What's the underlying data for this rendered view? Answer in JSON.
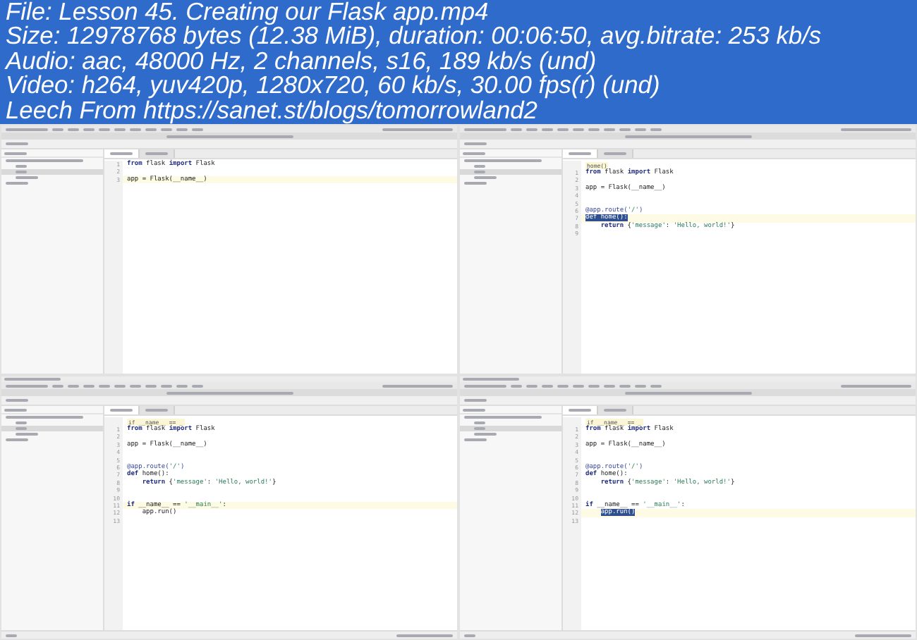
{
  "header": {
    "lines": [
      "File: Lesson 45. Creating our Flask app.mp4",
      "Size: 12978768 bytes (12.38 MiB), duration: 00:06:50, avg.bitrate: 253 kb/s",
      "Audio: aac, 48000 Hz, 2 channels, s16, 189 kb/s (und)",
      "Video: h264, yuv420p, 1280x720, 60 kb/s, 30.00 fps(r) (und)",
      "Leech From https://sanet.st/blogs/tomorrowland2"
    ]
  },
  "frames": [
    {
      "notification": false,
      "status_bar": false,
      "tabs": [
        {
          "selected": true
        },
        {
          "selected": false
        }
      ],
      "lines": [
        {
          "num": "1",
          "current": false,
          "tokens": [
            {
              "text": "from",
              "kind": "kw"
            },
            {
              "text": " flask ",
              "kind": "plain"
            },
            {
              "text": "import",
              "kind": "kw"
            },
            {
              "text": " Flask",
              "kind": "plain"
            }
          ]
        },
        {
          "num": "2",
          "current": false
        },
        {
          "num": "3",
          "current": true,
          "tokens": [
            {
              "text": "app = Flask(__name__)",
              "kind": "plain"
            }
          ]
        }
      ]
    },
    {
      "notification": false,
      "status_bar": false,
      "breadcrumb": "home()",
      "tabs": [
        {
          "selected": true
        },
        {
          "selected": false
        }
      ],
      "lines": [
        {
          "num": "1",
          "current": false,
          "tokens": [
            {
              "text": "from",
              "kind": "kw"
            },
            {
              "text": " flask ",
              "kind": "plain"
            },
            {
              "text": "import",
              "kind": "kw"
            },
            {
              "text": " Flask",
              "kind": "plain"
            }
          ]
        },
        {
          "num": "2",
          "current": false
        },
        {
          "num": "3",
          "current": false,
          "tokens": [
            {
              "text": "app = Flask(__name__)",
              "kind": "plain"
            }
          ]
        },
        {
          "num": "4",
          "current": false
        },
        {
          "num": "5",
          "current": false
        },
        {
          "num": "6",
          "current": false,
          "tokens": [
            {
              "text": "@app.route(",
              "kind": "deco"
            },
            {
              "text": "'/'",
              "kind": "str"
            },
            {
              "text": ")",
              "kind": "deco"
            }
          ]
        },
        {
          "num": "7",
          "current": true,
          "tokens": [
            {
              "text": "def home():",
              "kind": "sel"
            }
          ]
        },
        {
          "num": "8",
          "current": false,
          "indented": true,
          "tokens": [
            {
              "text": "return",
              "kind": "kw"
            },
            {
              "text": " {",
              "kind": "plain"
            },
            {
              "text": "'message'",
              "kind": "str"
            },
            {
              "text": ": ",
              "kind": "plain"
            },
            {
              "text": "'Hello, world!'",
              "kind": "str"
            },
            {
              "text": "}",
              "kind": "plain"
            }
          ]
        },
        {
          "num": "9",
          "current": false
        }
      ]
    },
    {
      "notification": true,
      "status_bar": true,
      "breadcrumb": "if __name__ == _",
      "tabs": [
        {
          "selected": true
        },
        {
          "selected": false
        }
      ],
      "lines": [
        {
          "num": "1",
          "current": false,
          "tokens": [
            {
              "text": "from",
              "kind": "kw"
            },
            {
              "text": " flask ",
              "kind": "plain"
            },
            {
              "text": "import",
              "kind": "kw"
            },
            {
              "text": " Flask",
              "kind": "plain"
            }
          ]
        },
        {
          "num": "2",
          "current": false
        },
        {
          "num": "3",
          "current": false,
          "tokens": [
            {
              "text": "app = Flask(__name__)",
              "kind": "plain"
            }
          ]
        },
        {
          "num": "4",
          "current": false
        },
        {
          "num": "5",
          "current": false
        },
        {
          "num": "6",
          "current": false,
          "tokens": [
            {
              "text": "@app.route(",
              "kind": "deco"
            },
            {
              "text": "'/'",
              "kind": "str"
            },
            {
              "text": ")",
              "kind": "deco"
            }
          ]
        },
        {
          "num": "7",
          "current": false,
          "tokens": [
            {
              "text": "def",
              "kind": "kw"
            },
            {
              "text": " home():",
              "kind": "plain"
            }
          ]
        },
        {
          "num": "8",
          "current": false,
          "indented": true,
          "tokens": [
            {
              "text": "return",
              "kind": "kw"
            },
            {
              "text": " {",
              "kind": "plain"
            },
            {
              "text": "'message'",
              "kind": "str"
            },
            {
              "text": ": ",
              "kind": "plain"
            },
            {
              "text": "'Hello, world!'",
              "kind": "str"
            },
            {
              "text": "}",
              "kind": "plain"
            }
          ]
        },
        {
          "num": "9",
          "current": false
        },
        {
          "num": "10",
          "current": false
        },
        {
          "num": "11",
          "current": true,
          "tokens": [
            {
              "text": "if",
              "kind": "kw"
            },
            {
              "text": " __name__ == ",
              "kind": "plain"
            },
            {
              "text": "'__main__'",
              "kind": "str"
            },
            {
              "text": ":",
              "kind": "plain"
            }
          ]
        },
        {
          "num": "12",
          "current": false,
          "indented": true,
          "tokens": [
            {
              "text": "app.run()",
              "kind": "plain"
            }
          ]
        },
        {
          "num": "13",
          "current": false
        }
      ]
    },
    {
      "notification": true,
      "status_bar": true,
      "breadcrumb": "if __name__ == _",
      "tabs": [
        {
          "selected": true
        },
        {
          "selected": false
        }
      ],
      "lines": [
        {
          "num": "1",
          "current": false,
          "tokens": [
            {
              "text": "from",
              "kind": "kw"
            },
            {
              "text": " flask ",
              "kind": "plain"
            },
            {
              "text": "import",
              "kind": "kw"
            },
            {
              "text": " Flask",
              "kind": "plain"
            }
          ]
        },
        {
          "num": "2",
          "current": false
        },
        {
          "num": "3",
          "current": false,
          "tokens": [
            {
              "text": "app = Flask(__name__)",
              "kind": "plain"
            }
          ]
        },
        {
          "num": "4",
          "current": false
        },
        {
          "num": "5",
          "current": false
        },
        {
          "num": "6",
          "current": false,
          "tokens": [
            {
              "text": "@app.route(",
              "kind": "deco"
            },
            {
              "text": "'/'",
              "kind": "str"
            },
            {
              "text": ")",
              "kind": "deco"
            }
          ]
        },
        {
          "num": "7",
          "current": false,
          "tokens": [
            {
              "text": "def",
              "kind": "kw"
            },
            {
              "text": " home():",
              "kind": "plain"
            }
          ]
        },
        {
          "num": "8",
          "current": false,
          "indented": true,
          "tokens": [
            {
              "text": "return",
              "kind": "kw"
            },
            {
              "text": " {",
              "kind": "plain"
            },
            {
              "text": "'message'",
              "kind": "str"
            },
            {
              "text": ": ",
              "kind": "plain"
            },
            {
              "text": "'Hello, world!'",
              "kind": "str"
            },
            {
              "text": "}",
              "kind": "plain"
            }
          ]
        },
        {
          "num": "9",
          "current": false
        },
        {
          "num": "10",
          "current": false
        },
        {
          "num": "11",
          "current": false,
          "tokens": [
            {
              "text": "if",
              "kind": "kw"
            },
            {
              "text": " __name__ == ",
              "kind": "plain"
            },
            {
              "text": "'__main__'",
              "kind": "str"
            },
            {
              "text": ":",
              "kind": "plain"
            }
          ]
        },
        {
          "num": "12",
          "current": true,
          "indented": true,
          "tokens": [
            {
              "text": "app.run()",
              "kind": "sel"
            }
          ]
        },
        {
          "num": "13",
          "current": false
        }
      ]
    }
  ]
}
